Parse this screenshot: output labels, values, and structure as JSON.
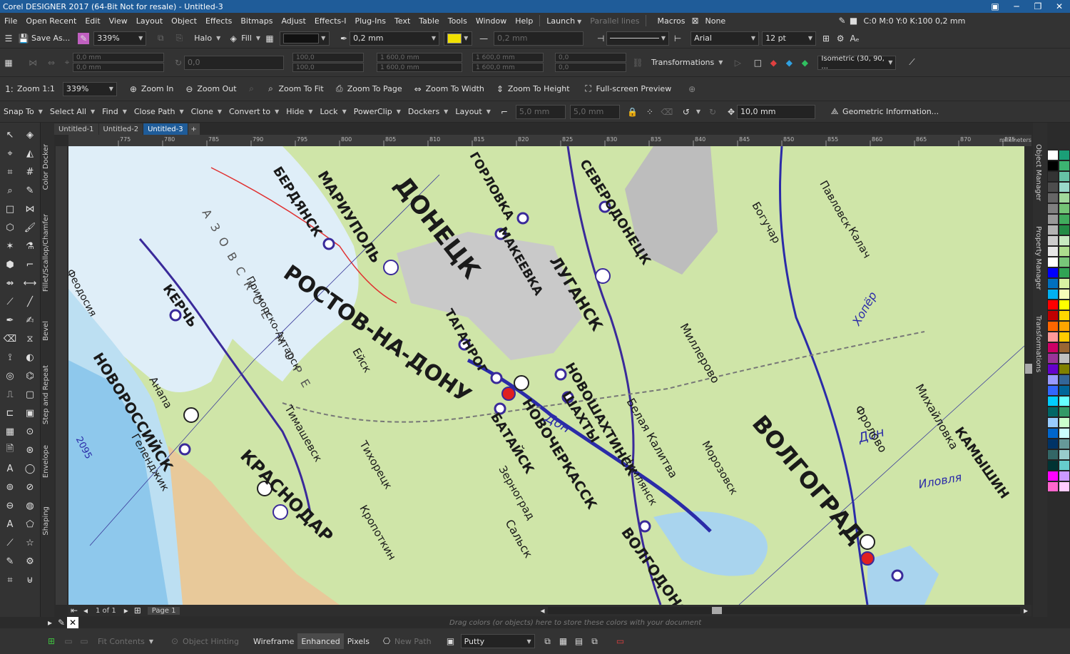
{
  "window": {
    "title": "Corel DESIGNER 2017 (64-Bit Not for resale) - Untitled-3"
  },
  "menubar": {
    "items": [
      "File",
      "Open Recent",
      "Edit",
      "View",
      "Layout",
      "Object",
      "Effects",
      "Bitmaps",
      "Adjust",
      "Effects-I",
      "Plug-Ins",
      "Text",
      "Table",
      "Tools",
      "Window",
      "Help",
      "Launch"
    ],
    "parallel_lines": "Parallel lines",
    "macros": "Macros",
    "fill_none": "None",
    "color_readout": "C:0 M:0 Y:0 K:100  0,2 mm"
  },
  "toolbar1": {
    "save_as": "Save As...",
    "zoom_value": "339%",
    "halo": "Halo",
    "fill": "Fill",
    "outline_width": "0,2 mm",
    "outline_width2": "0,2 mm",
    "font_name": "Arial",
    "font_size": "12 pt"
  },
  "toolbar2": {
    "x_pos": "0,0 mm",
    "y_pos": "0,0 mm",
    "angle": "0,0",
    "scale_x": "100,0",
    "scale_y": "100,0",
    "x_coord": "1 600,0 mm",
    "y_coord": "1 600,0 mm",
    "w_size": "1 600,0 mm",
    "h_size": "1 600,0 mm",
    "rot_a": "0,0",
    "rot_b": "0,0",
    "transformations": "Transformations",
    "projection": "Isometric (30, 90, ..."
  },
  "toolbar3": {
    "zoom_1_1": "Zoom 1:1",
    "zoom_value": "339%",
    "zoom_in": "Zoom In",
    "zoom_out": "Zoom Out",
    "zoom_to_fit": "Zoom To Fit",
    "zoom_to_page": "Zoom To Page",
    "zoom_to_width": "Zoom To Width",
    "zoom_to_height": "Zoom To Height",
    "fullscreen": "Full-screen Preview"
  },
  "toolbar4": {
    "items": [
      "Snap To",
      "Select All",
      "Find",
      "Close Path",
      "Clone",
      "Convert to",
      "Hide",
      "Lock",
      "PowerClip",
      "Dockers",
      "Layout"
    ],
    "size_a": "5,0 mm",
    "size_b": "5,0 mm",
    "nudge": "10,0 mm",
    "geometric_info": "Geometric Information..."
  },
  "doc_tabs": [
    "Untitled-1",
    "Untitled-2",
    "Untitled-3"
  ],
  "ruler": {
    "units": "millimeters",
    "ticks": [
      "775",
      "780",
      "785",
      "790",
      "795",
      "800",
      "805",
      "810",
      "815",
      "820",
      "825",
      "830",
      "835",
      "840",
      "845",
      "850",
      "855",
      "860",
      "865",
      "870",
      "875",
      "880"
    ]
  },
  "left_dock_tabs": [
    "Color Docker",
    "Fillet/Scallop/Chamfer",
    "Bevel",
    "Step and Repeat",
    "Envelope",
    "Shaping"
  ],
  "right_dock_tabs": [
    "Object Manager",
    "Property Manager",
    "Transformations"
  ],
  "map_labels": {
    "rostov": "РОСТОВ-НА-ДОНУ",
    "donetsk": "ДОНЕЦК",
    "volgograd": "ВОЛГОГРАД",
    "lugansk": "ЛУГАНСК",
    "mariupol": "МАРИУПОЛЬ",
    "berdyansk": "БЕРДЯНСК",
    "kerch": "КЕРЧЬ",
    "novorossiysk": "НОВОРОССИЙСК",
    "krasnodar": "КРАСНОДАР",
    "taganrog": "ТАГАНРОГ",
    "novocherkassk": "НОВОЧЕРКАССК",
    "bataysk": "БАТАЙСК",
    "shakhty": "ШАХТЫ",
    "novoshakhtinsk": "НОВОШАХТИНСК",
    "volgodonsk": "ВОЛГОДОНСК",
    "makeevka": "МАКЕЕВКА",
    "severodonetsk": "СЕВЕРОДОНЕЦК",
    "gorlovka": "ГОРЛОВКА",
    "azov_sea": "АЗОВСКОЕ МОРЕ",
    "don": "Дон",
    "khoper": "Хопёр",
    "ilovlya": "Иловля",
    "kamyshin": "КАМЫШИН",
    "mikhaylovka": "Михайловка",
    "frolovo": "Фролово",
    "millerovo": "Миллерово",
    "belaya_kalitva": "Белая Калитва",
    "zernograd": "Зерноград",
    "salsk": "Сальск",
    "eysk": "Ейск",
    "anapa": "Анапа",
    "gelendzhik": "Геленджик",
    "tikhoretsk": "Тихорецк",
    "kropotkin": "Кропоткин",
    "timashevsk": "Тимашевск",
    "kalach": "Калач",
    "pavlovsk": "Павловск",
    "boguchar": "Богучар",
    "tsimlyansk": "Цимлянск",
    "morozovsk": "Морозовск",
    "primorsko": "Приморско-Ахтарск",
    "feodosiya": "Феодосия",
    "num_2095": "2095"
  },
  "hscroll": {
    "page_info": "1 of 1",
    "page_name": "Page 1"
  },
  "colorbar": {
    "hint": "Drag colors (or objects) here to store these colors with your document"
  },
  "statusbar": {
    "fit_contents": "Fit Contents",
    "object_hinting": "Object Hinting",
    "wireframe": "Wireframe",
    "enhanced": "Enhanced",
    "pixels": "Pixels",
    "new_path": "New Path",
    "material": "Putty"
  },
  "palette_colors": [
    "#ffffff",
    "#1b9e77",
    "#000000",
    "#3cb371",
    "#333333",
    "#66c2a5",
    "#4d4d4d",
    "#99d8c9",
    "#666666",
    "#a1d99b",
    "#808080",
    "#74c476",
    "#999999",
    "#41ab5d",
    "#b3b3b3",
    "#238b45",
    "#cccccc",
    "#c7e9c0",
    "#e6e6e6",
    "#addd8e",
    "#ffffff",
    "#78c679",
    "#0000ff",
    "#31a354",
    "#0070c0",
    "#d9f0a3",
    "#00b0f0",
    "#f7fcb9",
    "#ff0000",
    "#ffff00",
    "#c00000",
    "#ffd700",
    "#ff6600",
    "#ffa500",
    "#ff9999",
    "#ffcc00",
    "#cc0066",
    "#996633",
    "#993399",
    "#c0c0c0",
    "#6600cc",
    "#808000",
    "#9999ff",
    "#336699",
    "#3366ff",
    "#006699",
    "#00ccff",
    "#66ffff",
    "#006666",
    "#339966",
    "#99ccff",
    "#ccffcc",
    "#0066cc",
    "#ccffff",
    "#003366",
    "#669999",
    "#336666",
    "#99cccc",
    "#003333",
    "#66cccc",
    "#ff00ff",
    "#cc99ff",
    "#ff66cc",
    "#ffccff"
  ]
}
